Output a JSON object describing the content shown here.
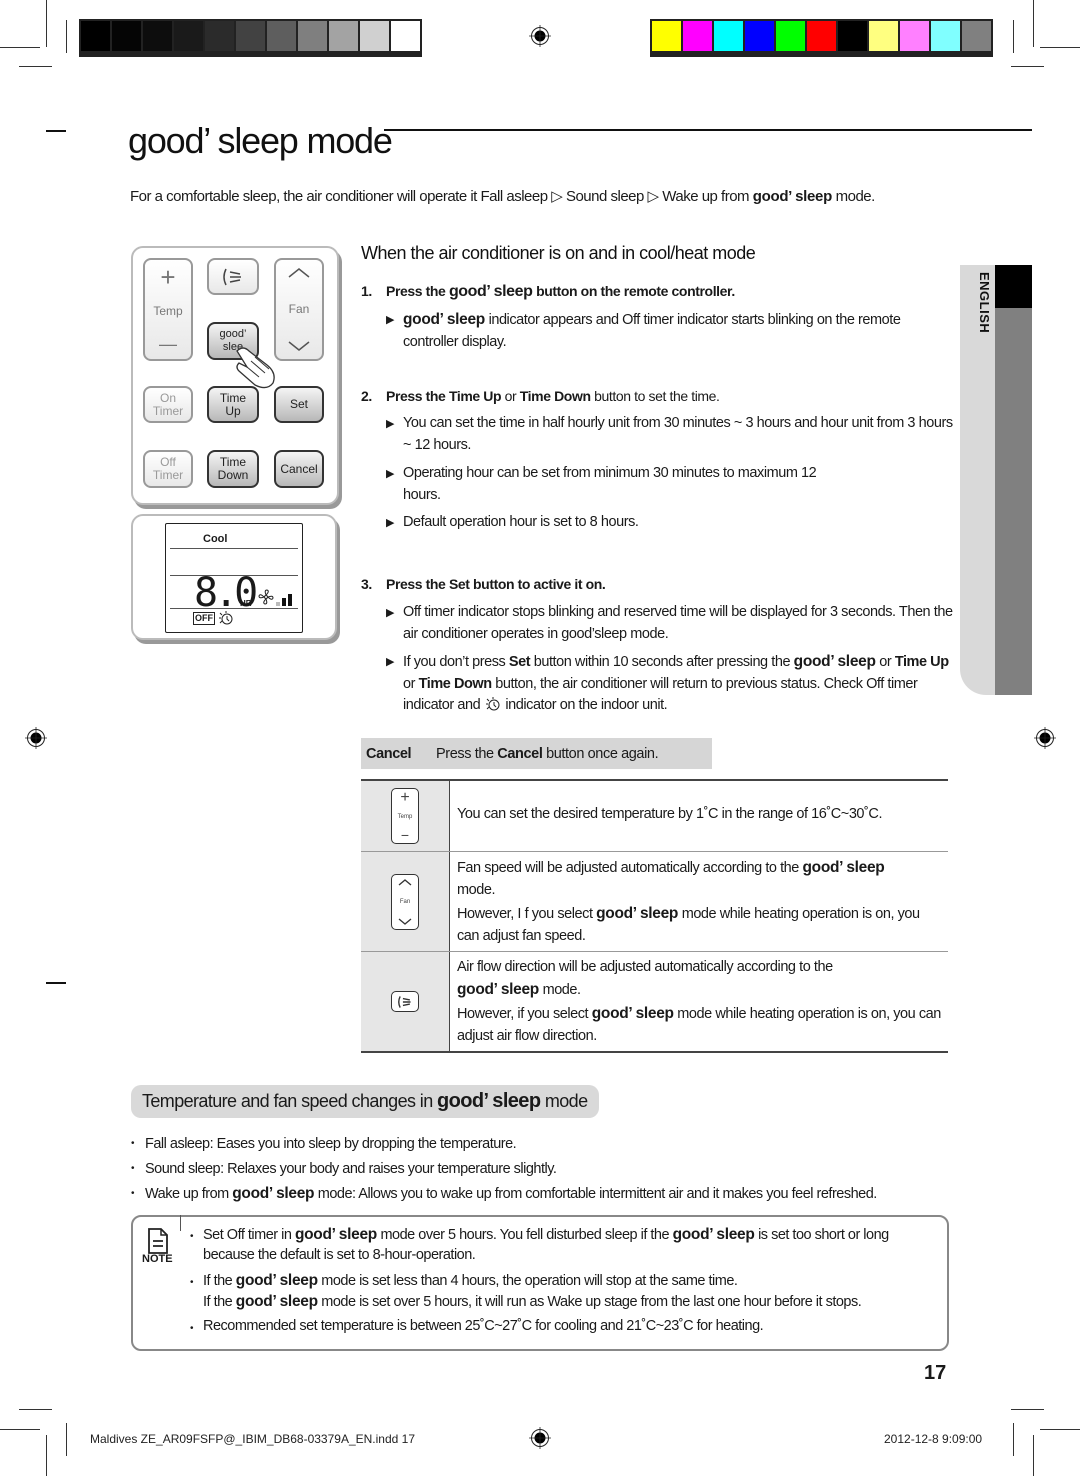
{
  "print_marks": {
    "grayscale_swatches": [
      "#000000",
      "#050505",
      "#0d0d0d",
      "#1a1a1a",
      "#2b2b2b",
      "#424242",
      "#5e5e5e",
      "#7f7f7f",
      "#a3a3a3",
      "#d0d0d0",
      "#ffffff"
    ],
    "color_swatches": [
      "#ffff00",
      "#ff00ff",
      "#00ffff",
      "#0000ff",
      "#00ff00",
      "#ff0000",
      "#000000",
      "#ffff80",
      "#ff80ff",
      "#80ffff",
      "#808080"
    ]
  },
  "title": {
    "brand": "good’ sleep",
    "suffix": "mode"
  },
  "intro": {
    "part1": "For a comfortable sleep, the air conditioner will operate it Fall asleep",
    "part2": "Sound sleep",
    "part3": "Wake up from",
    "brand": "good’ sleep",
    "part4": "mode.",
    "arrow": "▷"
  },
  "remote": {
    "temp_label": "Temp",
    "temp_plus": "+",
    "temp_minus": "—",
    "fan_label": "Fan",
    "good_sleep": "good’ slee",
    "on_timer": "On Timer",
    "time_up": "Time Up",
    "set": "Set",
    "off_timer": "Off Timer",
    "time_down": "Time Down",
    "cancel": "Cancel"
  },
  "display": {
    "mode": "Cool",
    "time_value": "8.0",
    "time_unit": "HR",
    "off_label": "OFF",
    "fan_level": 0.66
  },
  "section1": {
    "heading": "When the air conditioner is on and in cool/heat mode",
    "step1": {
      "num": "1.",
      "pre": "Press the",
      "brand": "good’ sleep",
      "post": "button on the remote controller.",
      "bullets": [
        {
          "brand": "good’ sleep",
          "text": "indicator appears and Off timer indicator starts blinking on the remote controller display."
        }
      ]
    },
    "step2": {
      "num": "2.",
      "pre": "Press the",
      "b1": "Time Up",
      "mid": "or",
      "b2": "Time Down",
      "post": "button to set the time.",
      "bullets": [
        "You can set the time in half hourly unit from 30 minutes ~ 3 hours and hour unit from 3 hours ~ 12 hours.",
        "Operating hour can be set from minimum 30 minutes to maximum 12 hours.",
        "Default operation hour is set to 8 hours."
      ]
    },
    "step3": {
      "num": "3.",
      "pre": "Press the",
      "b1": "Set",
      "post": "button to active it on.",
      "bullet1": "Off timer indicator stops blinking and reserved time will be displayed for 3 seconds. Then the air conditioner operates in good’sleep mode.",
      "bullet2": {
        "t1": "If you don’t press",
        "b1": "Set",
        "t2": "button within 10 seconds after pressing the",
        "brand": "good’ sleep",
        "t3": "or",
        "b2": "Time Up",
        "t4": "or",
        "b3": "Time Down",
        "t5": "button, the air conditioner will return to previous status. Check Off timer indicator and",
        "t6": "indicator on the indoor unit."
      }
    },
    "bullet_marker": "▶"
  },
  "cancel_bar": {
    "label": "Cancel",
    "pre": "Press the",
    "bold": "Cancel",
    "post": "button once again."
  },
  "table": {
    "rows": [
      {
        "icon": "temp-button-icon",
        "icon_label": "Temp",
        "text": "You can set the desired temperature by 1˚C in the range of 16˚C~30˚C."
      },
      {
        "icon": "fan-button-icon",
        "icon_label": "Fan",
        "line1_pre": "Fan speed will be adjusted automatically according to the",
        "brand": "good’ sleep",
        "line1_post": "mode.",
        "line2_pre": "However, I f you select",
        "line2_post": "mode while heating operation is on, you can adjust fan speed."
      },
      {
        "icon": "airflow-button-icon",
        "line1_pre": "Air flow direction will be adjusted automatically according to the",
        "brand": "good’ sleep",
        "line1_post": "mode.",
        "line2_pre": "However, if you select",
        "line2_post": "mode while heating operation is on, you can adjust air flow direction."
      }
    ]
  },
  "section2": {
    "heading_pre": "Temperature and fan speed changes in",
    "brand": "good’ sleep",
    "heading_post": "mode",
    "bullets": [
      {
        "text": "Fall asleep: Eases you into sleep by dropping the temperature."
      },
      {
        "text": "Sound sleep: Relaxes your body and raises your temperature slightly."
      },
      {
        "pre": "Wake up from",
        "brand": "good’ sleep",
        "text": "mode: Allows you to wake up from comfortable intermittent air and it makes you feel refreshed."
      }
    ],
    "bullet_marker": "•"
  },
  "note": {
    "label": "NOTE",
    "l1_pre": "Set Off timer in",
    "l1_mid": "mode over 5 hours. You fell disturbed sleep if the",
    "l1_post": "is set too short or long",
    "l2": "because the default is set to 8-hour-operation.",
    "l3_pre": "If the",
    "l3_post": "mode is set less than 4 hours, the operation will stop at the same time.",
    "l4_pre": "If the",
    "l4_post": "mode is set over 5 hours, it will run as Wake up stage from the last one hour before it stops.",
    "l5": "Recommended set temperature is between 25˚C~27˚C for cooling and 21˚C~23˚C for heating.",
    "brand": "good’ sleep"
  },
  "language_tab": "ENGLISH",
  "page_number": "17",
  "footer": {
    "file": "Maldives ZE_AR09FSFP@_IBIM_DB68-03379A_EN.indd   17",
    "timestamp": "2012-12-8   9:09:00"
  }
}
